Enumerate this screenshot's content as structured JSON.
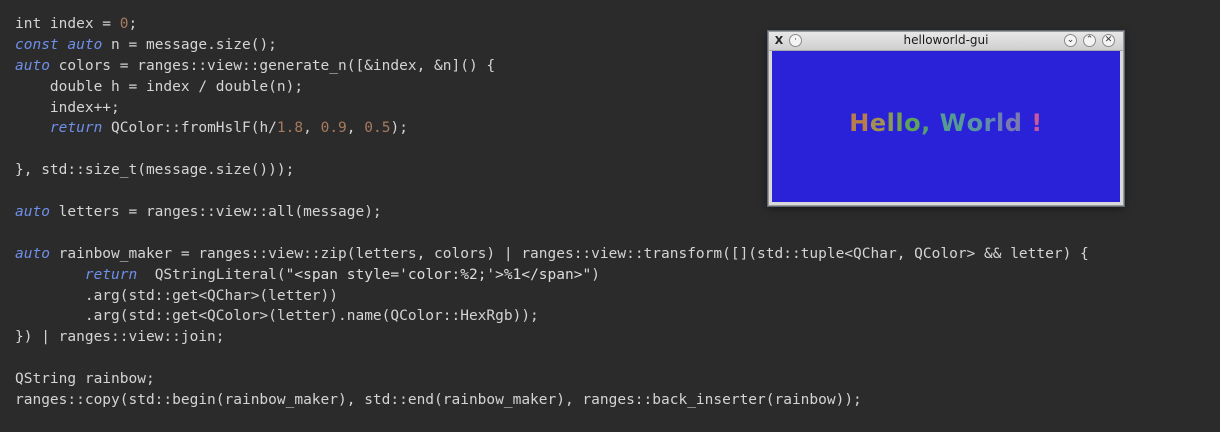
{
  "editor": {
    "lines": [
      [
        {
          "t": "int index = ",
          "c": "plain"
        },
        {
          "t": "0",
          "c": "number"
        },
        {
          "t": ";",
          "c": "plain"
        }
      ],
      [
        {
          "t": "const",
          "c": "keyword"
        },
        {
          "t": " ",
          "c": "plain"
        },
        {
          "t": "auto",
          "c": "keyword"
        },
        {
          "t": " n = message.size();",
          "c": "plain"
        }
      ],
      [
        {
          "t": "auto",
          "c": "keyword"
        },
        {
          "t": " colors = ranges::view::generate_n([&index, &n]() {",
          "c": "plain"
        }
      ],
      [
        {
          "t": "    double h = index / double(n);",
          "c": "plain"
        }
      ],
      [
        {
          "t": "    index++;",
          "c": "plain"
        }
      ],
      [
        {
          "t": "    ",
          "c": "plain"
        },
        {
          "t": "return",
          "c": "keyword"
        },
        {
          "t": " QColor::fromHslF(h/",
          "c": "plain"
        },
        {
          "t": "1.8",
          "c": "number"
        },
        {
          "t": ", ",
          "c": "plain"
        },
        {
          "t": "0.9",
          "c": "number"
        },
        {
          "t": ", ",
          "c": "plain"
        },
        {
          "t": "0.5",
          "c": "number"
        },
        {
          "t": ");",
          "c": "plain"
        }
      ],
      [],
      [
        {
          "t": "}, std::size_t(message.size()));",
          "c": "plain"
        }
      ],
      [],
      [
        {
          "t": "auto",
          "c": "keyword"
        },
        {
          "t": " letters = ranges::view::all(message);",
          "c": "plain"
        }
      ],
      [],
      [
        {
          "t": "auto",
          "c": "keyword"
        },
        {
          "t": " rainbow_maker = ranges::view::zip(letters, colors) | ranges::view::transform([](std::tuple<QChar, QColor> && letter) {",
          "c": "plain"
        }
      ],
      [
        {
          "t": "        ",
          "c": "plain"
        },
        {
          "t": "return",
          "c": "keyword"
        },
        {
          "t": "  QStringLiteral(",
          "c": "plain"
        },
        {
          "t": "\"<span style='color:%2;'>%1</span>\"",
          "c": "string"
        },
        {
          "t": ")",
          "c": "plain"
        }
      ],
      [
        {
          "t": "        .arg(std::get<QChar>(letter))",
          "c": "plain"
        }
      ],
      [
        {
          "t": "        .arg(std::get<QColor>(letter).name(QColor::HexRgb));",
          "c": "plain"
        }
      ],
      [
        {
          "t": "}) | ranges::view::join;",
          "c": "plain"
        }
      ],
      [],
      [
        {
          "t": "QString rainbow;",
          "c": "plain"
        }
      ],
      [
        {
          "t": "ranges::copy(std::begin(rainbow_maker), std::end(rainbow_maker), ranges::back_inserter(rainbow));",
          "c": "plain"
        }
      ]
    ],
    "colors": {
      "plain": "#d4d4d4",
      "keyword": "#6f8fe8",
      "number": "#a77b5d",
      "string": "#dcdcdc",
      "background": "#2b2b2b"
    }
  },
  "window": {
    "title": "helloworld-gui",
    "icons": {
      "app": "x11-logo-icon",
      "pin": "pin-icon",
      "minimize": "minimize-icon",
      "maximize": "maximize-icon",
      "close": "close-icon"
    },
    "client_background": "#2a22d8",
    "hello_letters": [
      {
        "ch": "H",
        "color": "#b77d4b"
      },
      {
        "ch": "e",
        "color": "#a39050"
      },
      {
        "ch": "l",
        "color": "#8f9a51"
      },
      {
        "ch": "l",
        "color": "#74a052"
      },
      {
        "ch": "o",
        "color": "#5fa25a"
      },
      {
        "ch": ",",
        "color": "#55a06e"
      },
      {
        "ch": " ",
        "color": "#55a083"
      },
      {
        "ch": "W",
        "color": "#559b94"
      },
      {
        "ch": "o",
        "color": "#5a93a2"
      },
      {
        "ch": "r",
        "color": "#618aab"
      },
      {
        "ch": "l",
        "color": "#6b80b0"
      },
      {
        "ch": "d",
        "color": "#7a79b2"
      },
      {
        "ch": " ",
        "color": "#8b74ad"
      },
      {
        "ch": "!",
        "color": "#c85a9a"
      }
    ]
  }
}
